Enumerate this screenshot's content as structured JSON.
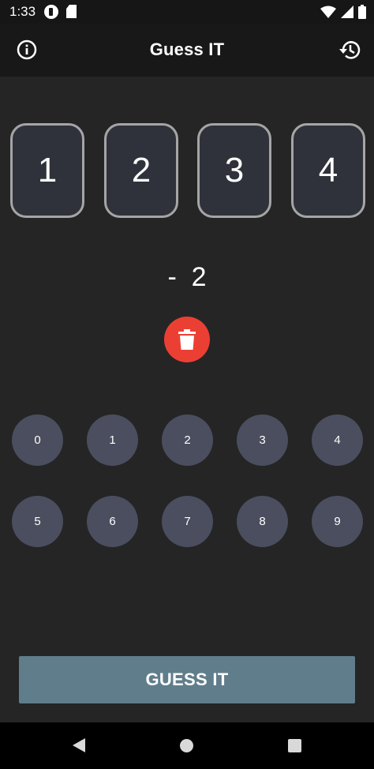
{
  "status_bar": {
    "time": "1:33",
    "icons": [
      "notification-icon",
      "sd-card-icon",
      "wifi-icon",
      "signal-icon",
      "battery-icon"
    ]
  },
  "app_bar": {
    "title": "Guess IT",
    "left_icon": "info-icon",
    "right_icon": "history-icon"
  },
  "digits": [
    "1",
    "2",
    "3",
    "4"
  ],
  "result": "-  2",
  "delete_icon": "trash-icon",
  "keypad": {
    "row1": [
      "0",
      "1",
      "2",
      "3",
      "4"
    ],
    "row2": [
      "5",
      "6",
      "7",
      "8",
      "9"
    ]
  },
  "guess_button": "GUESS IT",
  "colors": {
    "background": "#252525",
    "app_bar": "#181818",
    "digit_box_border": "#a5a5a5",
    "digit_box_fill": "#2f323a",
    "delete_button": "#ec3f34",
    "key": "#4a4e5e",
    "guess_button": "#607d8b"
  },
  "nav_bar": {
    "icons": [
      "back-icon",
      "home-icon",
      "recents-icon"
    ]
  }
}
